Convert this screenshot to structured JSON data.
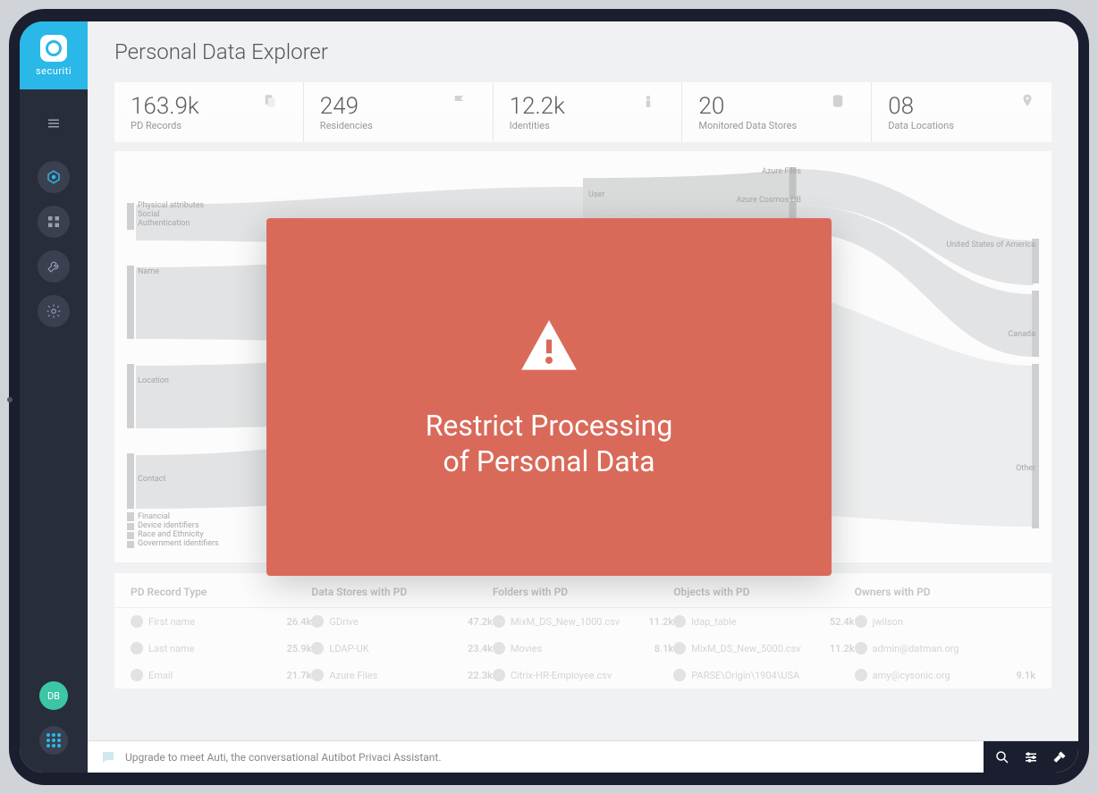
{
  "brand": "securiti",
  "page_title": "Personal Data Explorer",
  "sidebar": {
    "avatar_initials": "DB"
  },
  "stats": [
    {
      "value": "163.9k",
      "label": "PD Records",
      "icon": "documents"
    },
    {
      "value": "249",
      "label": "Residencies",
      "icon": "flag"
    },
    {
      "value": "12.2k",
      "label": "Identities",
      "icon": "person"
    },
    {
      "value": "20",
      "label": "Monitored Data Stores",
      "icon": "database"
    },
    {
      "value": "08",
      "label": "Data Locations",
      "icon": "pin"
    }
  ],
  "sankey": {
    "left_labels": [
      "Physical attributes",
      "Social",
      "Authentication",
      "Name",
      "Location",
      "Contact",
      "Financial",
      "Device identifiers",
      "Race and Ethnicity",
      "Government identifiers"
    ],
    "mid_labels": [
      "User"
    ],
    "right_labels": [
      "Azure Files",
      "Azure Cosmos DB",
      "United States of America",
      "Other",
      "Canada"
    ]
  },
  "table": {
    "headers": [
      "PD Record Type",
      "Data Stores with PD",
      "Folders with PD",
      "Objects with PD",
      "Owners with PD"
    ],
    "rows": [
      {
        "c0": "First name",
        "n0": "26.4k",
        "c1": "GDrive",
        "n1": "47.2k",
        "c2": "MixM_DS_New_1000.csv",
        "n2": "11.2k",
        "c3": "ldap_table",
        "n3": "52.4k",
        "c4": "jwilson",
        "n4": ""
      },
      {
        "c0": "Last name",
        "n0": "25.9k",
        "c1": "LDAP-UK",
        "n1": "23.4k",
        "c2": "Movies",
        "n2": "8.1k",
        "c3": "MixM_DS_New_5000.csv",
        "n3": "11.2k",
        "c4": "admin@datman.org",
        "n4": ""
      },
      {
        "c0": "Email",
        "n0": "21.7k",
        "c1": "Azure Files",
        "n1": "22.3k",
        "c2": "Citrix-HR-Employee.csv",
        "n2": "",
        "c3": "PARSE\\Origin\\1904\\USA",
        "n3": "",
        "c4": "amy@cysonic.org",
        "n4": "9.1k"
      }
    ]
  },
  "footer": {
    "message": "Upgrade to meet Auti, the conversational Autibot Privaci Assistant."
  },
  "modal": {
    "line1": "Restrict Processing",
    "line2": "of Personal Data"
  }
}
